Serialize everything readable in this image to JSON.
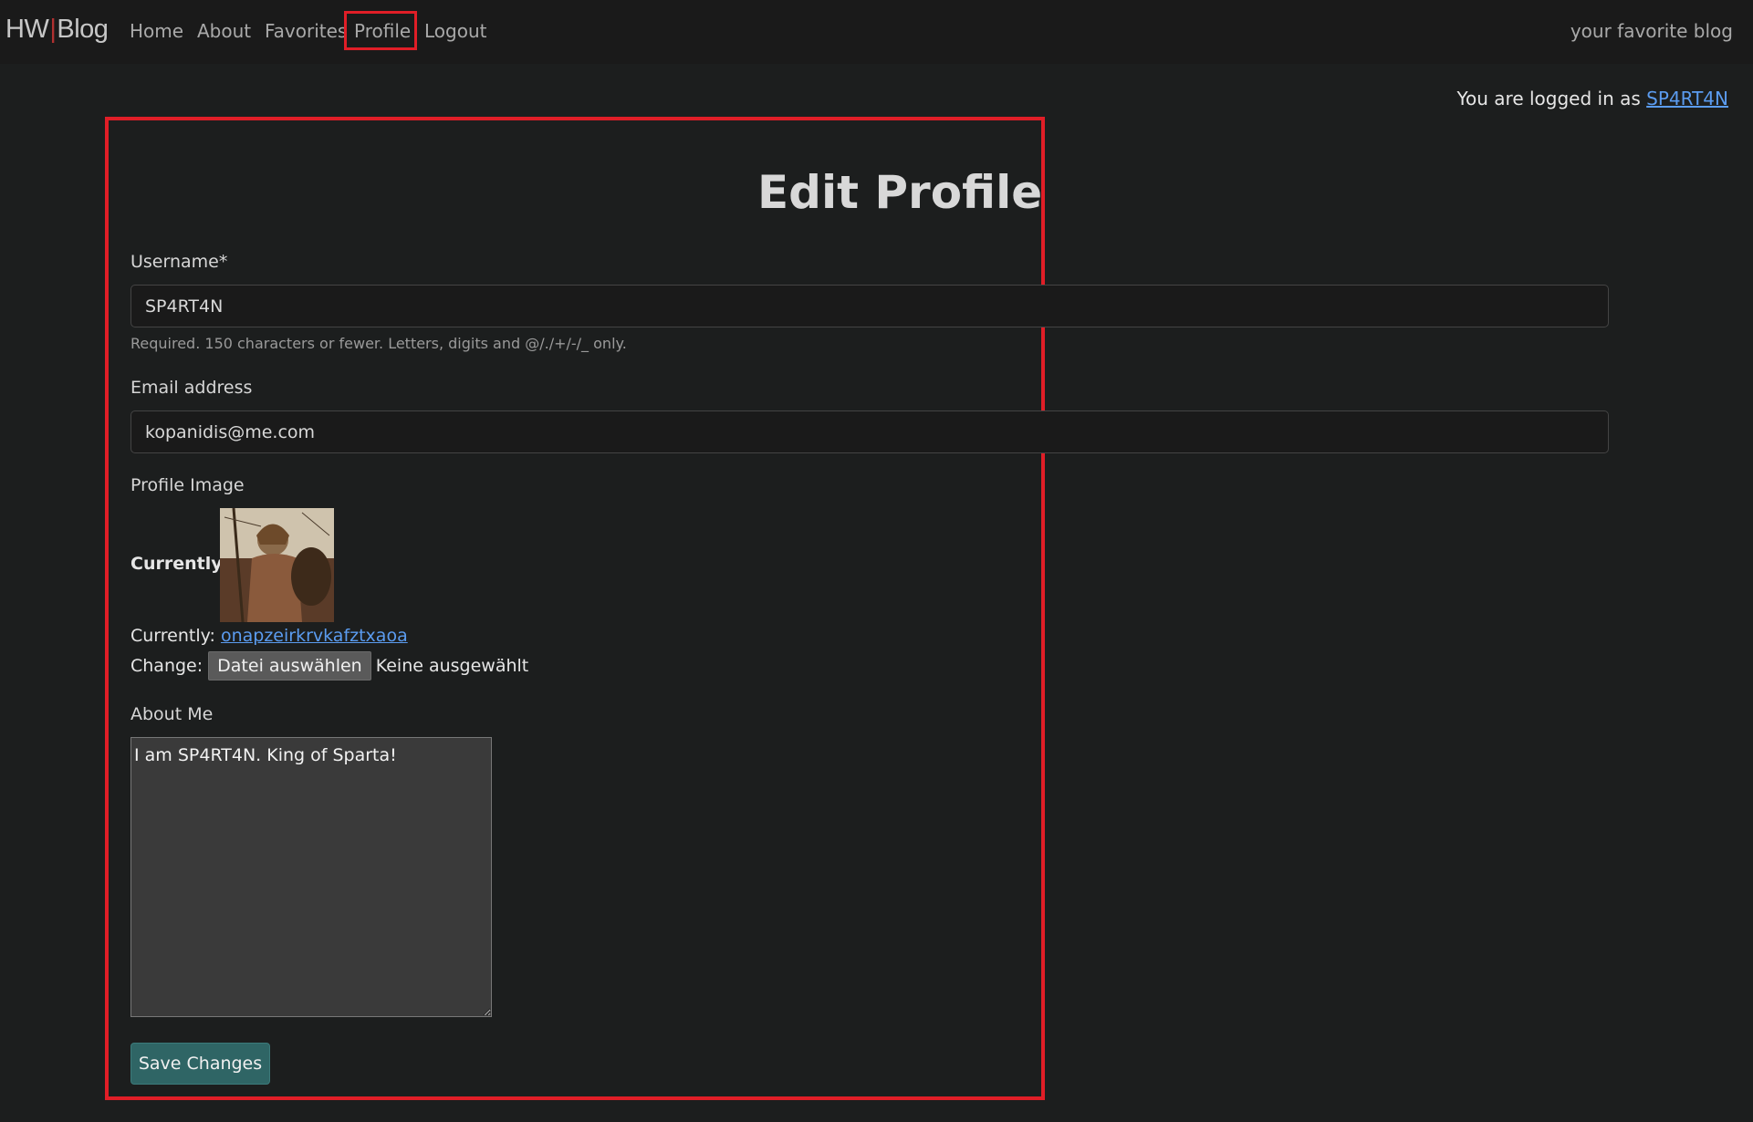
{
  "navbar": {
    "brand_left": "HW",
    "brand_sep": "|",
    "brand_right": "Blog",
    "links": [
      "Home",
      "About",
      "Favorites",
      "Profile",
      "Logout"
    ],
    "tagline": "your favorite blog"
  },
  "login": {
    "prefix": "You are logged in as",
    "username": "SP4RT4N"
  },
  "form": {
    "title": "Edit Profile",
    "username_label": "Username*",
    "username_value": "SP4RT4N",
    "username_help": "Required. 150 characters or fewer. Letters, digits and @/./+/-/_ only.",
    "email_label": "Email address",
    "email_value": "kopanidis@me.com",
    "image_label": "Profile Image",
    "currently_bold": "Currently:",
    "currently_prefix": "Currently:",
    "currently_file": "onapzeirkrvkafztxaoa",
    "change_prefix": "Change:",
    "file_button": "Datei auswählen",
    "file_none": "Keine ausgewählt",
    "about_label": "About Me",
    "about_value": "I am SP4RT4N. King of Sparta!",
    "save_button": "Save Changes"
  },
  "colors": {
    "highlight": "#e01e27",
    "link": "#5b9cf0",
    "save_button": "#2f6565"
  }
}
